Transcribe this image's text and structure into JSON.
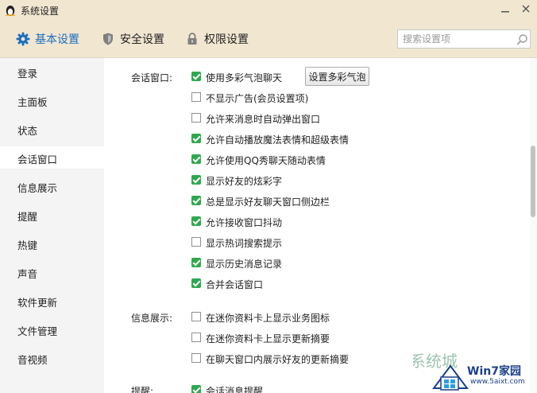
{
  "window": {
    "title": "系统设置"
  },
  "tabs": [
    {
      "label": "基本设置",
      "active": true
    },
    {
      "label": "安全设置",
      "active": false
    },
    {
      "label": "权限设置",
      "active": false
    }
  ],
  "search": {
    "placeholder": "搜索设置项"
  },
  "sidebar": {
    "items": [
      {
        "label": "登录"
      },
      {
        "label": "主面板"
      },
      {
        "label": "状态"
      },
      {
        "label": "会话窗口",
        "active": true
      },
      {
        "label": "信息展示"
      },
      {
        "label": "提醒"
      },
      {
        "label": "热键"
      },
      {
        "label": "声音"
      },
      {
        "label": "软件更新"
      },
      {
        "label": "文件管理"
      },
      {
        "label": "音视频"
      }
    ]
  },
  "sections": {
    "session": {
      "label": "会话窗口:",
      "button_label": "设置多彩气泡",
      "options": [
        {
          "label": "使用多彩气泡聊天",
          "checked": true
        },
        {
          "label": "不显示广告(会员设置项)",
          "checked": false
        },
        {
          "label": "允许来消息时自动弹出窗口",
          "checked": false
        },
        {
          "label": "允许自动播放魔法表情和超级表情",
          "checked": true
        },
        {
          "label": "允许使用QQ秀聊天随动表情",
          "checked": true
        },
        {
          "label": "显示好友的炫彩字",
          "checked": true
        },
        {
          "label": "总是显示好友聊天窗口侧边栏",
          "checked": true
        },
        {
          "label": "允许接收窗口抖动",
          "checked": true
        },
        {
          "label": "显示热词搜索提示",
          "checked": false
        },
        {
          "label": "显示历史消息记录",
          "checked": true
        },
        {
          "label": "合并会话窗口",
          "checked": true
        }
      ]
    },
    "info": {
      "label": "信息展示:",
      "options": [
        {
          "label": "在迷你资料卡上显示业务图标",
          "checked": false
        },
        {
          "label": "在迷你资料卡上显示更新摘要",
          "checked": false
        },
        {
          "label": "在聊天窗口内展示好友的更新摘要",
          "checked": false
        }
      ]
    },
    "reminder": {
      "label": "提醒:",
      "options": [
        {
          "label": "会话消息提醒",
          "checked": true
        }
      ]
    }
  },
  "watermark": {
    "title": "Win7家园",
    "url": "www.5aixt.com",
    "ghost_text": "系统城"
  },
  "colors": {
    "chrome": "#f1e6d0",
    "accent": "#1a6fc0",
    "check": "#2fa84f",
    "sidebar": "#f4f4f4"
  },
  "icons": {
    "app": "qq-penguin-icon",
    "minimize": "minimize-icon",
    "close": "close-icon",
    "basic_tab": "gear-icon",
    "security_tab": "shield-icon",
    "permission_tab": "lock-icon",
    "search": "search-icon"
  }
}
